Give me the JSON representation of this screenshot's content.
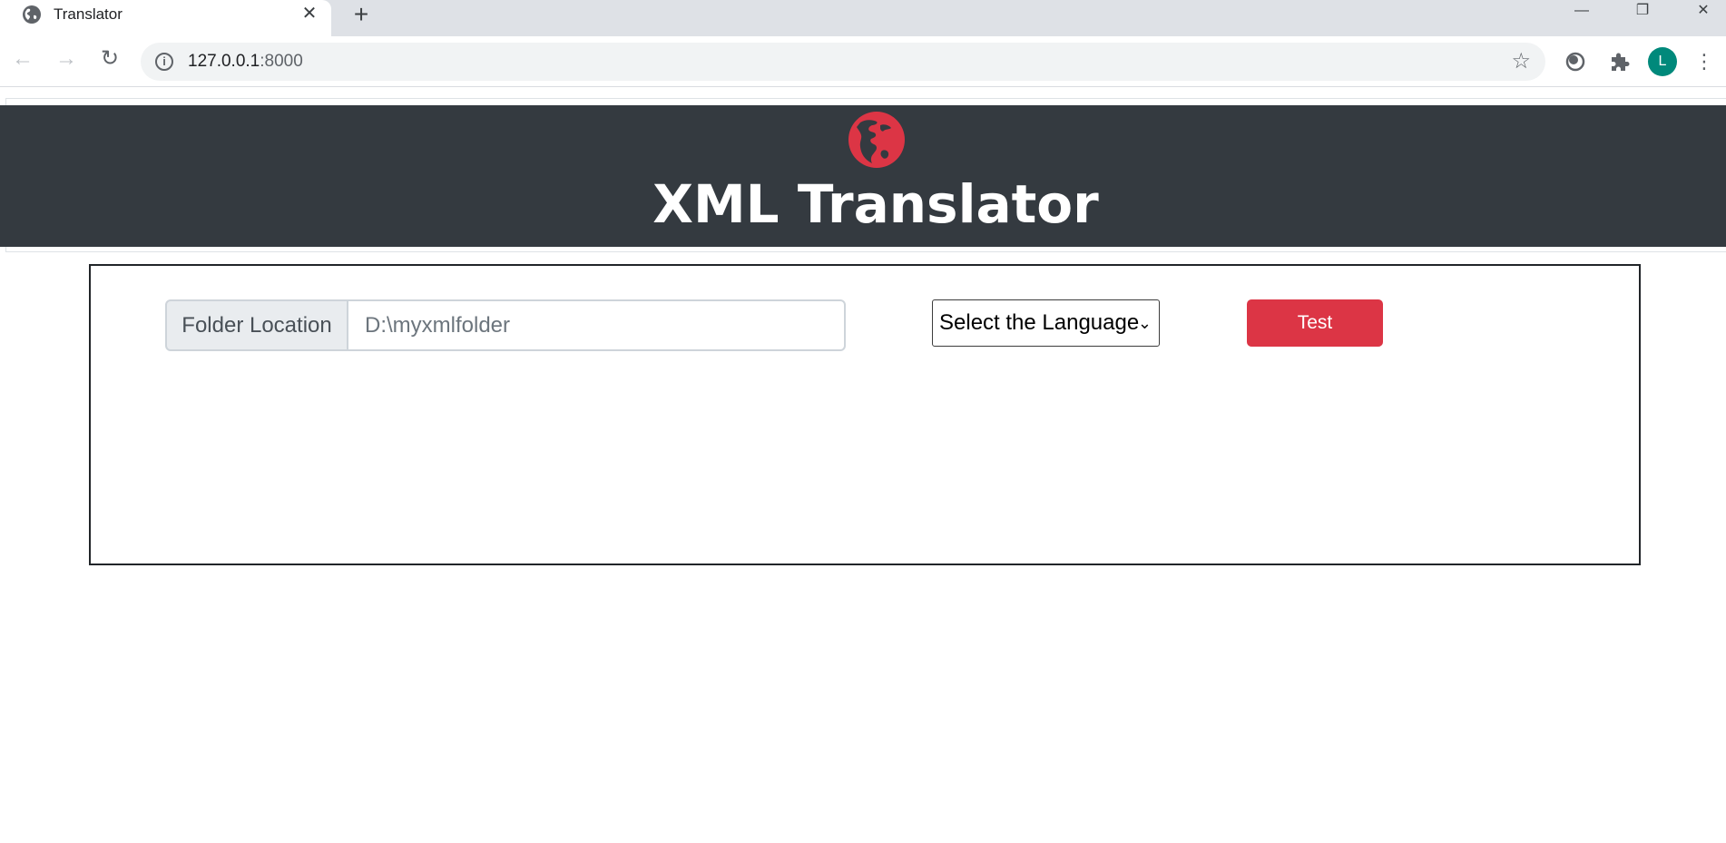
{
  "browser": {
    "tab_title": "Translator",
    "tab_close_icon": "close-icon",
    "new_tab_icon": "plus-icon",
    "url_host": "127.0.0.1",
    "url_port": ":8000",
    "avatar_initial": "L"
  },
  "header": {
    "logo_icon": "globe-americas-icon",
    "title": "XML Translator",
    "background_color": "#343a40",
    "logo_color": "#dc3545"
  },
  "form": {
    "folder_label": "Folder Location",
    "folder_placeholder": "D:\\myxmlfolder",
    "folder_value": "",
    "language_select_selected": "Select the Language",
    "test_button_label": "Test",
    "accent_color": "#dc3545"
  }
}
